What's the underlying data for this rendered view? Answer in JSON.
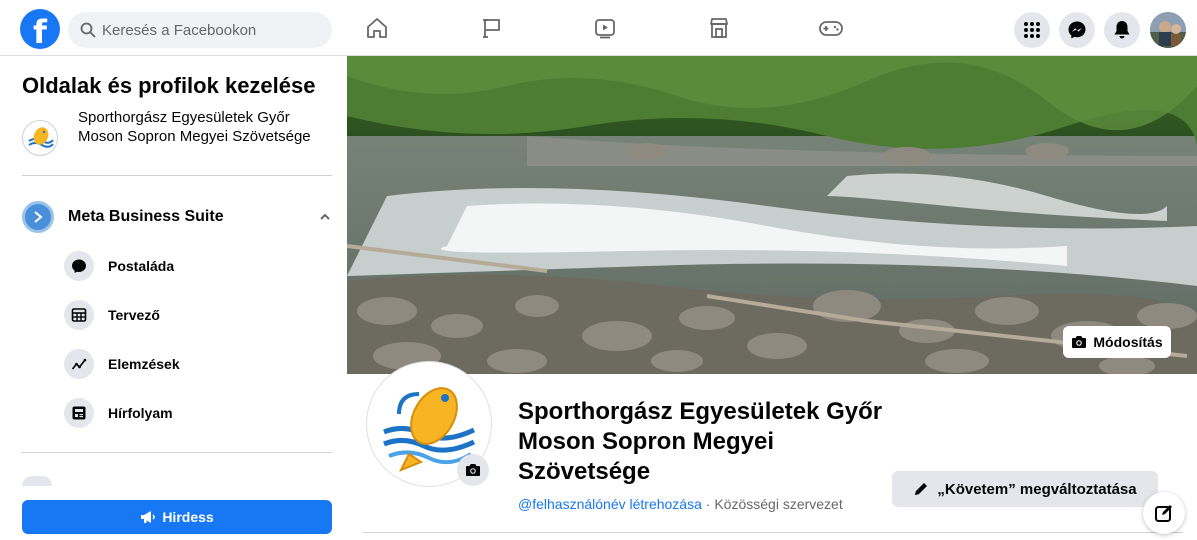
{
  "topbar": {
    "logo_letter": "f",
    "search_placeholder": "Keresés a Facebookon",
    "nav_icons": [
      "home-icon",
      "flag-icon",
      "video-icon",
      "marketplace-icon",
      "gaming-icon"
    ],
    "right_icons": [
      "menu-grid-icon",
      "messenger-icon",
      "notifications-icon",
      "avatar"
    ]
  },
  "sidebar": {
    "title": "Oldalak és profilok kezelése",
    "page_name": "Sporthorgász Egyesületek Győr Moson Sopron Megyei Szövetsége",
    "suite_label": "Meta Business Suite",
    "items": [
      {
        "label": "Postaláda",
        "icon": "chat-bubble-icon"
      },
      {
        "label": "Tervező",
        "icon": "calendar-icon"
      },
      {
        "label": "Elemzések",
        "icon": "insights-icon"
      },
      {
        "label": "Hírfolyam",
        "icon": "news-feed-icon"
      }
    ],
    "promote_label": "Hirdess"
  },
  "cover": {
    "edit_label": "Módosítás"
  },
  "profile": {
    "name": "Sporthorgász Egyesületek Győr Moson Sopron Megyei Szövetsége",
    "username_link": "@felhasználónév létrehozása",
    "separator": " · ",
    "category": "Közösségi szervezet",
    "follow_label": "„Követem” megváltoztatása"
  },
  "colors": {
    "brand": "#1877f2",
    "background": "#f0f2f5",
    "secondary_button": "#e4e6eb"
  }
}
